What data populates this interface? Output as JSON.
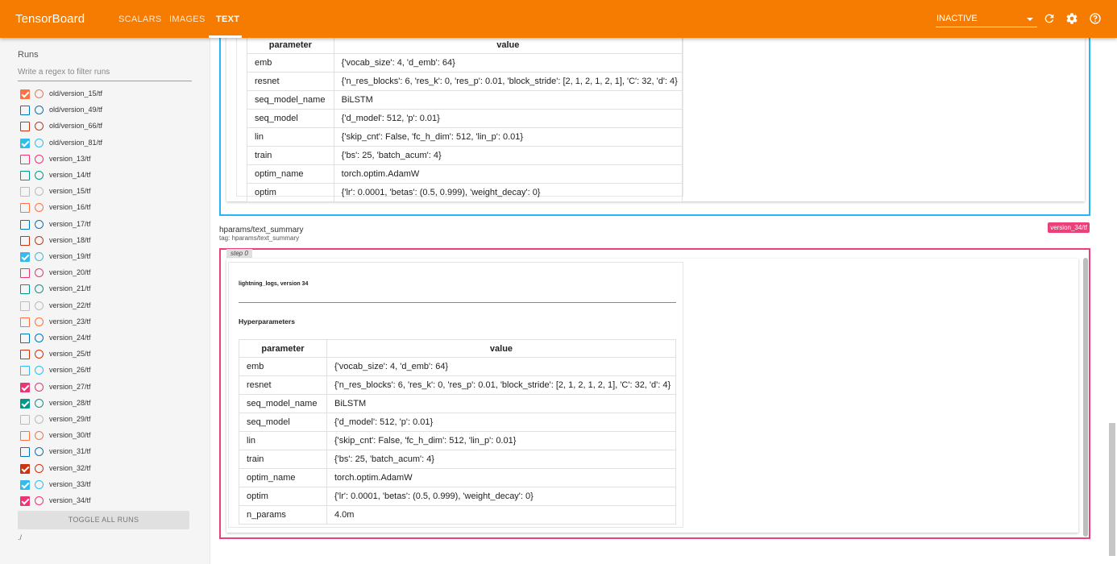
{
  "header": {
    "brand": "TensorBoard",
    "tabs": [
      {
        "label": "SCALARS"
      },
      {
        "label": "IMAGES"
      },
      {
        "label": "TEXT"
      }
    ],
    "run_select": "INACTIVE",
    "icons": [
      "refresh-icon",
      "settings-icon",
      "help-icon"
    ],
    "accent_color": "#f57c00"
  },
  "sidebar": {
    "title": "Runs",
    "filter_placeholder": "Write a regex to filter runs",
    "runs": [
      {
        "label": "old/version_15/tf",
        "checked": true,
        "color": "#ff7043"
      },
      {
        "label": "old/version_49/tf",
        "checked": false,
        "color": "#0077bb"
      },
      {
        "label": "old/version_66/tf",
        "checked": false,
        "color": "#cc3311"
      },
      {
        "label": "old/version_81/tf",
        "checked": true,
        "color": "#33bbee"
      },
      {
        "label": "version_13/tf",
        "checked": false,
        "color": "#ee3377"
      },
      {
        "label": "version_14/tf",
        "checked": false,
        "color": "#009988"
      },
      {
        "label": "version_15/tf",
        "checked": false,
        "color": "#bbbbbb"
      },
      {
        "label": "version_16/tf",
        "checked": false,
        "color": "#ff7043"
      },
      {
        "label": "version_17/tf",
        "checked": false,
        "color": "#0077bb"
      },
      {
        "label": "version_18/tf",
        "checked": false,
        "color": "#cc3311"
      },
      {
        "label": "version_19/tf",
        "checked": true,
        "color": "#33bbee"
      },
      {
        "label": "version_20/tf",
        "checked": false,
        "color": "#ee3377"
      },
      {
        "label": "version_21/tf",
        "checked": false,
        "color": "#009988"
      },
      {
        "label": "version_22/tf",
        "checked": false,
        "color": "#bbbbbb"
      },
      {
        "label": "version_23/tf",
        "checked": false,
        "color": "#ff7043"
      },
      {
        "label": "version_24/tf",
        "checked": false,
        "color": "#0077bb"
      },
      {
        "label": "version_25/tf",
        "checked": false,
        "color": "#cc3311"
      },
      {
        "label": "version_26/tf",
        "checked": false,
        "color": "#33bbee"
      },
      {
        "label": "version_27/tf",
        "checked": true,
        "color": "#ee3377"
      },
      {
        "label": "version_28/tf",
        "checked": true,
        "color": "#009988"
      },
      {
        "label": "version_29/tf",
        "checked": false,
        "color": "#bbbbbb"
      },
      {
        "label": "version_30/tf",
        "checked": false,
        "color": "#ff7043"
      },
      {
        "label": "version_31/tf",
        "checked": false,
        "color": "#0077bb"
      },
      {
        "label": "version_32/tf",
        "checked": true,
        "color": "#cc3311"
      },
      {
        "label": "version_33/tf",
        "checked": true,
        "color": "#33bbee"
      },
      {
        "label": "version_34/tf",
        "checked": true,
        "color": "#ee3377"
      }
    ],
    "toggle_label": "TOGGLE ALL RUNS",
    "logdir": "./"
  },
  "main": {
    "top_table": {
      "header": {
        "param": "parameter",
        "value": "value"
      },
      "rows": [
        {
          "param": "emb",
          "value": "{'vocab_size': 4, 'd_emb': 64}"
        },
        {
          "param": "resnet",
          "value": "{'n_res_blocks': 6, 'res_k': 0, 'res_p': 0.01, 'block_stride': [2, 1, 2, 1, 2, 1], 'C': 32, 'd': 4}"
        },
        {
          "param": "seq_model_name",
          "value": "BiLSTM"
        },
        {
          "param": "seq_model",
          "value": "{'d_model': 512, 'p': 0.01}"
        },
        {
          "param": "lin",
          "value": "{'skip_cnt': False, 'fc_h_dim': 512, 'lin_p': 0.01}"
        },
        {
          "param": "train",
          "value": "{'bs': 25, 'batch_acum': 4}"
        },
        {
          "param": "optim_name",
          "value": "torch.optim.AdamW"
        },
        {
          "param": "optim",
          "value": "{'lr': 0.0001, 'betas': (0.5, 0.999), 'weight_decay': 0}"
        }
      ]
    },
    "section": {
      "title": "hparams/text_summary",
      "tag": "tag: hparams/text_summary",
      "run_badge": "version_34/tf",
      "step": "step 0",
      "doc_title": "lightning_logs, version 34",
      "doc_heading": "Hyperparameters",
      "table": {
        "header": {
          "param": "parameter",
          "value": "value"
        },
        "rows": [
          {
            "param": "emb",
            "value": "{'vocab_size': 4, 'd_emb': 64}"
          },
          {
            "param": "resnet",
            "value": "{'n_res_blocks': 6, 'res_k': 0, 'res_p': 0.01, 'block_stride': [2, 1, 2, 1, 2, 1], 'C': 32, 'd': 4}"
          },
          {
            "param": "seq_model_name",
            "value": "BiLSTM"
          },
          {
            "param": "seq_model",
            "value": "{'d_model': 512, 'p': 0.01}"
          },
          {
            "param": "lin",
            "value": "{'skip_cnt': False, 'fc_h_dim': 512, 'lin_p': 0.01}"
          },
          {
            "param": "train",
            "value": "{'bs': 25, 'batch_acum': 4}"
          },
          {
            "param": "optim_name",
            "value": "torch.optim.AdamW"
          },
          {
            "param": "optim",
            "value": "{'lr': 0.0001, 'betas': (0.5, 0.999), 'weight_decay': 0}"
          },
          {
            "param": "n_params",
            "value": "4.0m"
          }
        ]
      }
    }
  }
}
